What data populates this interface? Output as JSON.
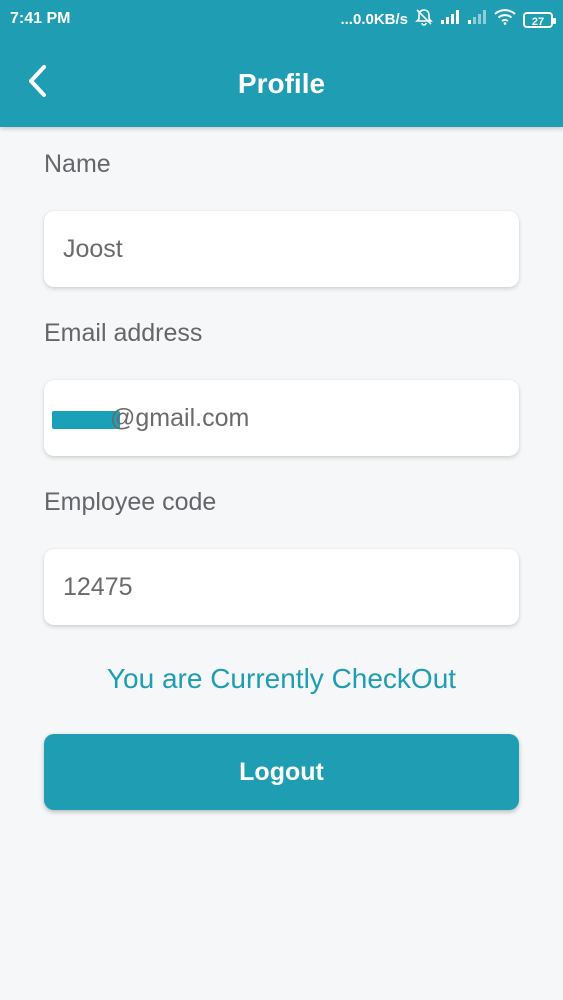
{
  "status_bar": {
    "time": "7:41 PM",
    "network_speed": "...0.0KB/s",
    "battery": "27",
    "icons": [
      "bell-off-icon",
      "signal-icon",
      "signal-weak-icon",
      "wifi-icon",
      "battery-icon"
    ]
  },
  "header": {
    "title": "Profile",
    "back_icon": "chevron-left-icon",
    "background_color": "#1e9db3"
  },
  "form": {
    "name_label": "Name",
    "name_value": "Joost",
    "email_label": "Email address",
    "email_value": "@gmail.com",
    "employee_code_label": "Employee code",
    "employee_code_value": "12475"
  },
  "status_message": "You are Currently CheckOut",
  "logout_button": "Logout",
  "colors": {
    "accent": "#1e9db3",
    "background": "#f6f7f8",
    "label_text": "#63666a"
  }
}
